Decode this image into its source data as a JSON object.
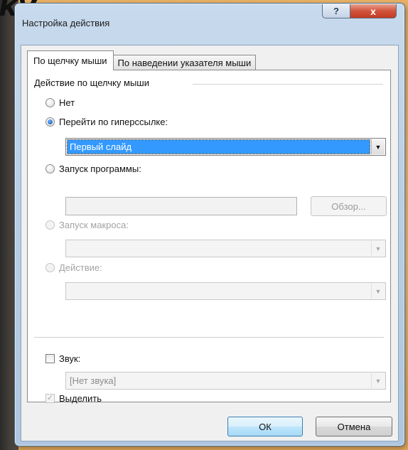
{
  "dialog": {
    "title": "Настройка действия",
    "help_label": "?",
    "close_label": "x"
  },
  "tabs": [
    {
      "label": "По щелчку мыши",
      "active": true
    },
    {
      "label": "По наведении указателя мыши",
      "active": false
    }
  ],
  "group": {
    "title": "Действие по щелчку мыши"
  },
  "options": {
    "none": {
      "label": "Нет",
      "checked": false
    },
    "hyperlink": {
      "label": "Перейти по гиперссылке:",
      "checked": true,
      "selected_value": "Первый слайд"
    },
    "run_program": {
      "label": "Запуск программы:",
      "checked": false,
      "browse_label": "Обзор..."
    },
    "run_macro": {
      "label": "Запуск макроса:",
      "disabled": true
    },
    "object_action": {
      "label": "Действие:",
      "disabled": true
    }
  },
  "sound": {
    "label": "Звук:",
    "checked": false,
    "selected_value": "[Нет звука]"
  },
  "highlight": {
    "label": "Выделить",
    "checked": true,
    "disabled": true
  },
  "buttons": {
    "ok_label": "ОК",
    "cancel_label": "Отмена"
  },
  "colors": {
    "selection": "#3399ff",
    "close_red": "#c23a22",
    "window_frame": "#b9cfe6"
  }
}
